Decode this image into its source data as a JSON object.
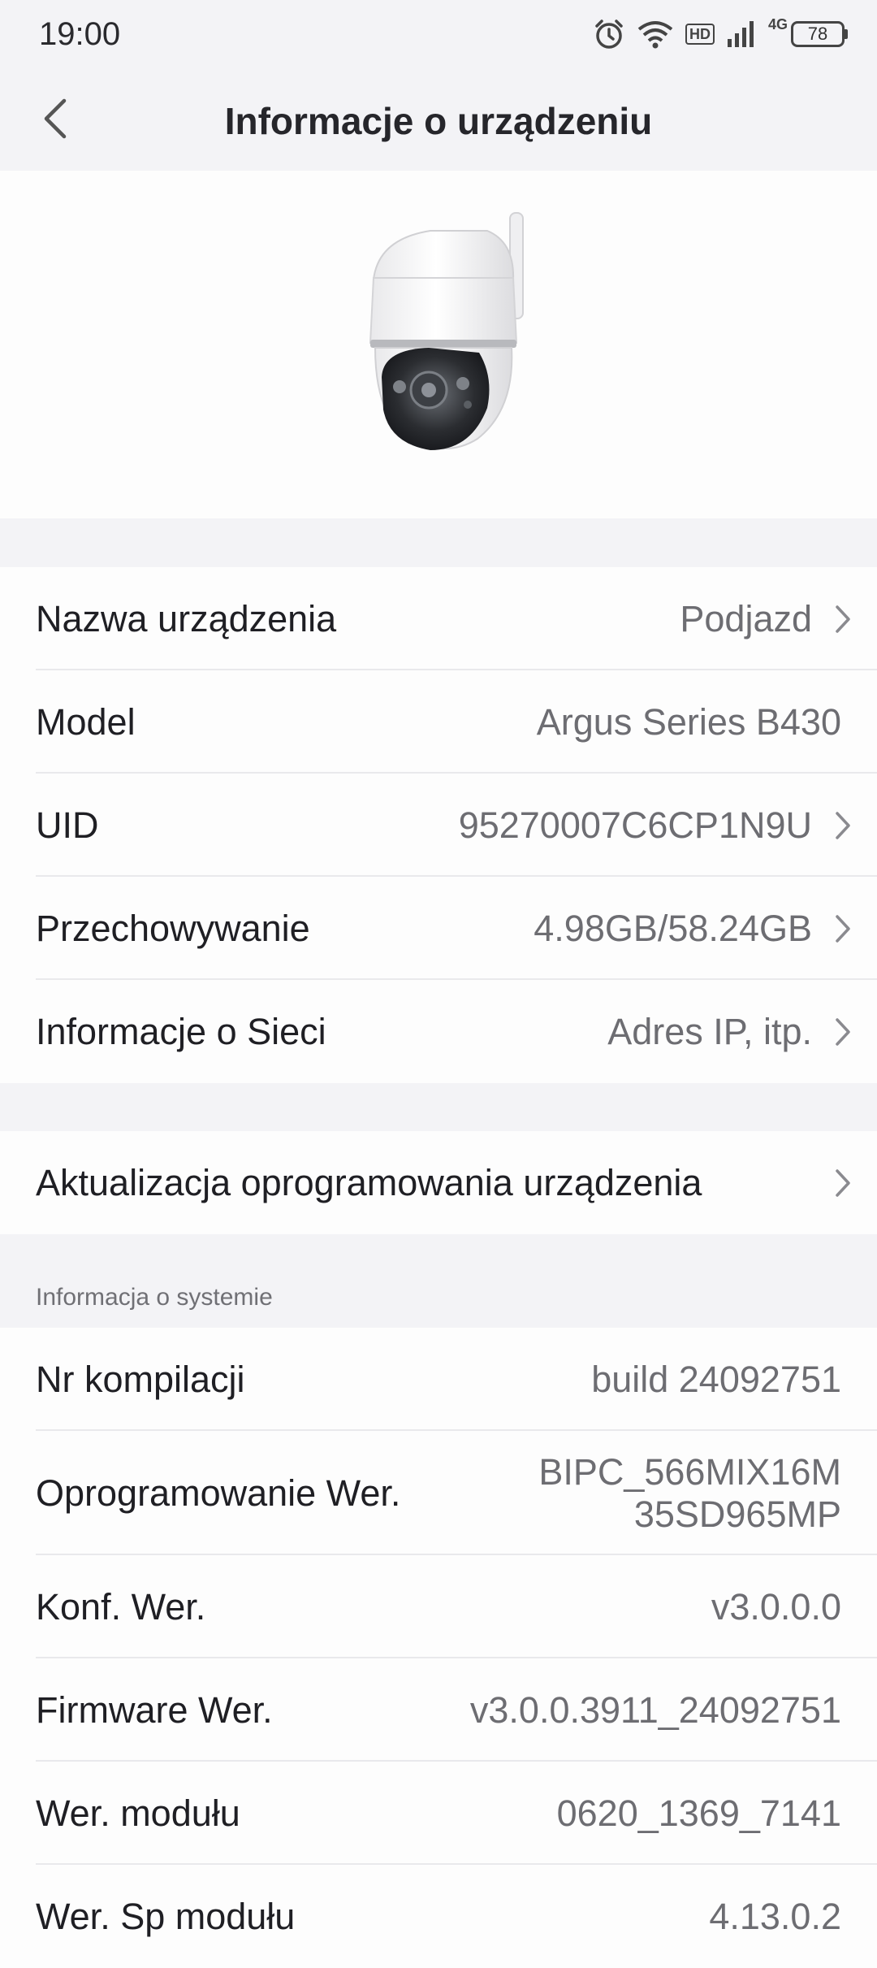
{
  "status_bar": {
    "time": "19:00",
    "hd": "HD",
    "network": "4G",
    "battery": "78"
  },
  "header": {
    "title": "Informacje o urządzeniu"
  },
  "device_rows": [
    {
      "label": "Nazwa urządzenia",
      "value": "Podjazd",
      "arrow": true
    },
    {
      "label": "Model",
      "value": "Argus Series B430",
      "arrow": false
    },
    {
      "label": "UID",
      "value": "95270007C6CP1N9U",
      "arrow": true
    },
    {
      "label": "Przechowywanie",
      "value": "4.98GB/58.24GB",
      "arrow": true
    },
    {
      "label": "Informacje o Sieci",
      "value": "Adres IP, itp.",
      "arrow": true
    }
  ],
  "update_row": {
    "label": "Aktualizacja oprogramowania urządzenia"
  },
  "system_section": {
    "title": "Informacja o systemie",
    "rows": [
      {
        "label": "Nr kompilacji",
        "value": "build 24092751"
      },
      {
        "label": "Oprogramowanie Wer.",
        "value": "BIPC_566MIX16M 35SD965MP"
      },
      {
        "label": "Konf. Wer.",
        "value": "v3.0.0.0"
      },
      {
        "label": "Firmware Wer.",
        "value": "v3.0.0.3911_24092751"
      },
      {
        "label": "Wer. modułu",
        "value": "0620_1369_7141"
      },
      {
        "label": "Wer. Sp modułu",
        "value": "4.13.0.2"
      }
    ]
  }
}
